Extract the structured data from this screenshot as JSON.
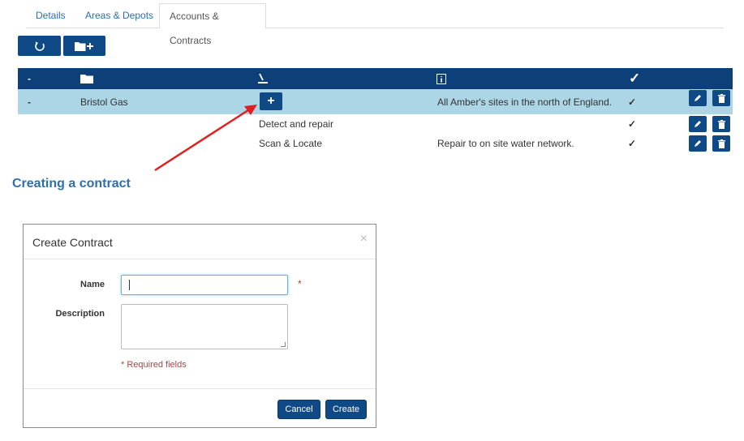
{
  "tabs": [
    {
      "label": "Details"
    },
    {
      "label": "Areas & Depots"
    },
    {
      "label": "Accounts & Contracts"
    }
  ],
  "toolbar": {
    "refresh_icon": "refresh-icon",
    "add_folder_icon": "folder-plus-icon"
  },
  "table": {
    "header": {
      "collapse": "-",
      "col_name_icon": "folder-icon",
      "col_sign_icon": "signature-icon",
      "col_desc_icon": "info-icon",
      "col_active_icon": "check-icon"
    },
    "rows": [
      {
        "toggle": "-",
        "name": "Bristol Gas",
        "contract": "",
        "description": "All Amber's sites in the north of England.",
        "active": "✓",
        "add_label": "+"
      },
      {
        "toggle": "",
        "name": "",
        "contract": "Detect and repair",
        "description": "",
        "active": "✓"
      },
      {
        "toggle": "",
        "name": "",
        "contract": "Scan & Locate",
        "description": "Repair to on site water network.",
        "active": "✓"
      }
    ]
  },
  "annotation": {
    "heading": "Creating a contract",
    "arrow_color": "#e02020"
  },
  "modal": {
    "title": "Create Contract",
    "close": "×",
    "name_label": "Name",
    "name_value": "",
    "required_star": "*",
    "description_label": "Description",
    "description_value": "",
    "required_note": "* Required fields",
    "cancel_label": "Cancel",
    "create_label": "Create"
  },
  "colors": {
    "primary": "#0f4a87",
    "header": "#0d3f78",
    "selected_row": "#acd6e5",
    "check": "#1f9a3a",
    "heading": "#2e6fad"
  }
}
